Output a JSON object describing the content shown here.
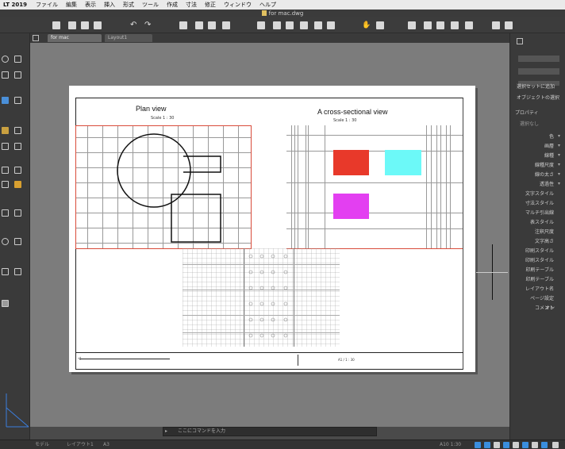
{
  "menubar": {
    "app_name": "LT 2019",
    "items": [
      "ファイル",
      "編集",
      "表示",
      "挿入",
      "形式",
      "ツール",
      "作成",
      "寸法",
      "修正",
      "ウィンドウ",
      "ヘルプ"
    ]
  },
  "window": {
    "title": "for mac.dwg"
  },
  "tabs": [
    {
      "label": "for mac",
      "active": true
    },
    {
      "label": "Layout1",
      "active": false
    }
  ],
  "drawing": {
    "plan_title": "Plan view",
    "plan_scale": "Scale 1 : 30",
    "section_title": "A cross-sectional view",
    "section_scale": "Scale 1 : 30",
    "title_block_text": "A1 / 1 : 30",
    "colors": {
      "red": "#e8392a",
      "cyan": "#6cf9f8",
      "magenta": "#e33ff1",
      "viewport_border": "#d94b3a"
    }
  },
  "command_line": {
    "placeholder": "ここにコマンドを入力"
  },
  "statusbar": {
    "tabs": [
      "モデル",
      "レイアウト1",
      "A3"
    ],
    "scale_label": "A10 1:30"
  },
  "properties": {
    "toolbar_label": "選択セットに追加",
    "quick_select": "オブジェクトの選択",
    "panel_title": "プロパティ",
    "no_selection": "選択なし",
    "rows": [
      "色",
      "画層",
      "線種",
      "線種尺度",
      "線の太さ",
      "透過性",
      "文字スタイル",
      "寸法スタイル",
      "マルチ引出線",
      "表スタイル",
      "注釈尺度",
      "文字高さ",
      "印刷スタイル",
      "印刷スタイル",
      "印刷テーブル",
      "印刷テーブル",
      "レイアウト名",
      "ページ設定",
      "コメント"
    ],
    "row_extra": "オン"
  }
}
